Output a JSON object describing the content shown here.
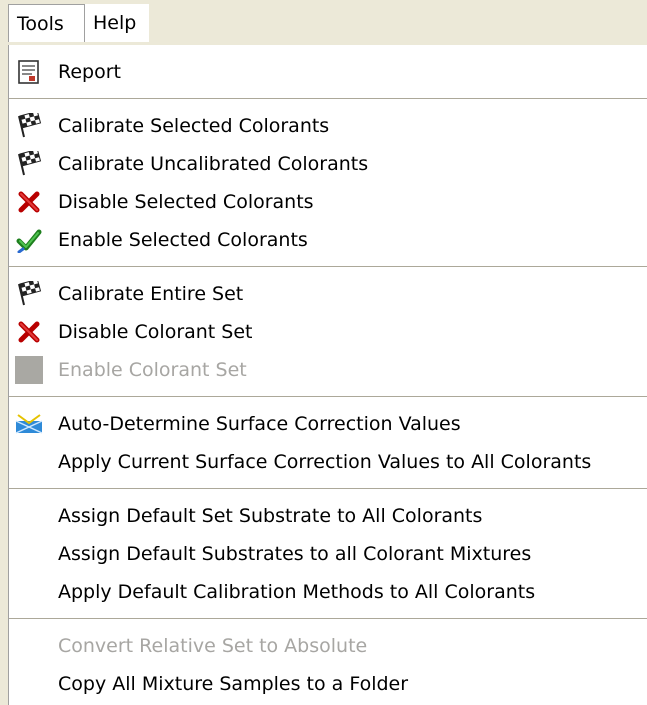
{
  "menubar": {
    "tools_label": "Tools",
    "help_label": "Help"
  },
  "menu": {
    "report": "Report",
    "calibrate_selected": "Calibrate Selected Colorants",
    "calibrate_uncalibrated": "Calibrate Uncalibrated Colorants",
    "disable_selected": "Disable Selected Colorants",
    "enable_selected": "Enable Selected Colorants",
    "calibrate_entire_set": "Calibrate Entire Set",
    "disable_colorant_set": "Disable Colorant Set",
    "enable_colorant_set": "Enable Colorant Set",
    "auto_determine": "Auto-Determine Surface Correction Values",
    "apply_current_surface": "Apply Current Surface Correction Values to All Colorants",
    "assign_default_set_substrate": "Assign Default Set Substrate to All Colorants",
    "assign_default_substrates": "Assign Default Substrates to all Colorant Mixtures",
    "apply_default_calibration": "Apply Default Calibration Methods to All Colorants",
    "convert_relative": "Convert Relative Set to Absolute",
    "copy_all_mixture": "Copy All Mixture Samples to a Folder"
  },
  "icons": {
    "report": "report-icon",
    "calibrate": "checkered-flag-icon",
    "disable": "red-x-icon",
    "enable": "green-check-icon",
    "enable_set": "gray-square-icon",
    "surface": "surface-correction-icon"
  },
  "colors": {
    "disabled_text": "#a7a6a3",
    "menubar_bg": "#ece9d8",
    "separator": "#aca899"
  }
}
